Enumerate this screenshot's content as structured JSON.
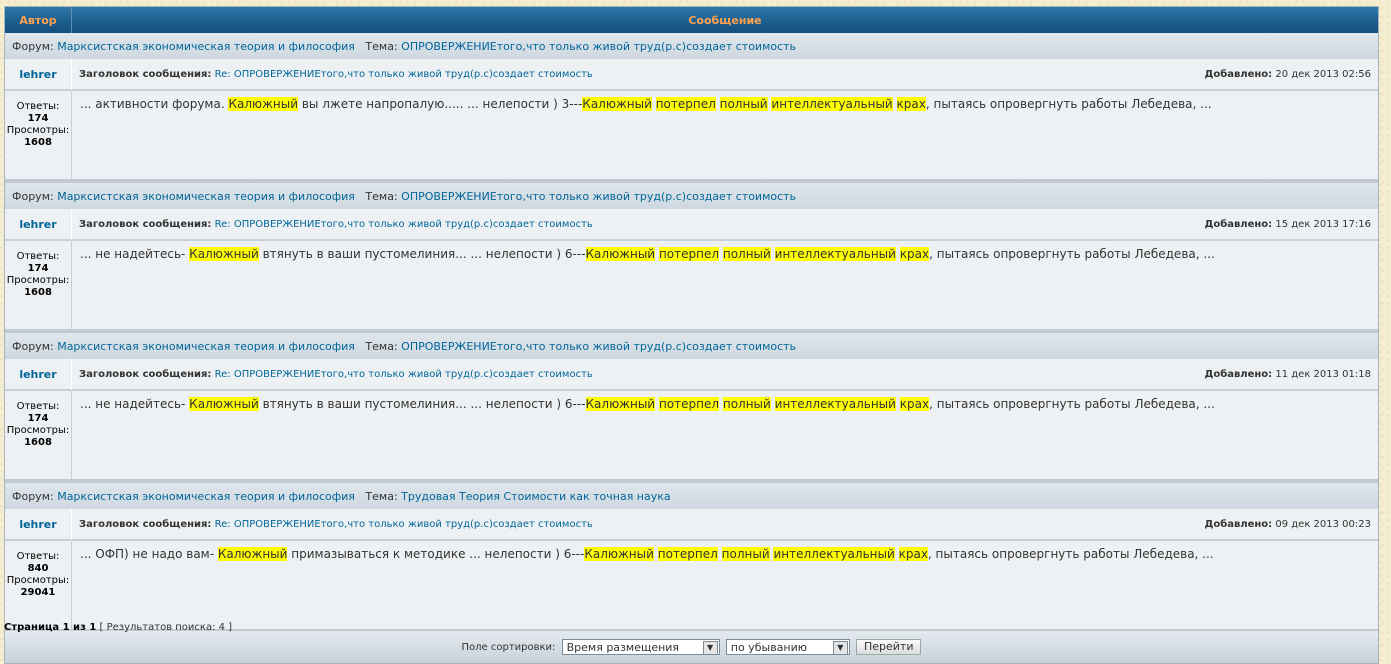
{
  "header": {
    "author": "Автор",
    "message": "Сообщение"
  },
  "labels": {
    "forum": "Форум:",
    "topic": "Тема:",
    "subject": "Заголовок сообщения:",
    "added": "Добавлено:",
    "replies": "Ответы:",
    "views": "Просмотры:"
  },
  "results": [
    {
      "forum": "Марксистская экономическая теория и философия",
      "topic": "ОПРОВЕРЖЕНИЕтого,что только живой труд(р.с)создает стоимость",
      "author": "lehrer",
      "subject": "Re: ОПРОВЕРЖЕНИЕтого,что только живой труд(р.с)создает стоимость",
      "date": "20 дек 2013 02:56",
      "replies": "174",
      "views": "1608",
      "text": [
        {
          "t": "... активности форума. ",
          "h": false
        },
        {
          "t": "Калюжный",
          "h": true
        },
        {
          "t": " вы лжете напропалую..... ... нелепости ) 3---",
          "h": false
        },
        {
          "t": "Калюжный",
          "h": true
        },
        {
          "t": " ",
          "h": false
        },
        {
          "t": "потерпел",
          "h": true
        },
        {
          "t": " ",
          "h": false
        },
        {
          "t": "полный",
          "h": true
        },
        {
          "t": " ",
          "h": false
        },
        {
          "t": "интеллектуальный",
          "h": true
        },
        {
          "t": " ",
          "h": false
        },
        {
          "t": "крах",
          "h": true
        },
        {
          "t": ", пытаясь опровергнуть работы Лебедева, ...",
          "h": false
        }
      ]
    },
    {
      "forum": "Марксистская экономическая теория и философия",
      "topic": "ОПРОВЕРЖЕНИЕтого,что только живой труд(р.с)создает стоимость",
      "author": "lehrer",
      "subject": "Re: ОПРОВЕРЖЕНИЕтого,что только живой труд(р.с)создает стоимость",
      "date": "15 дек 2013 17:16",
      "replies": "174",
      "views": "1608",
      "text": [
        {
          "t": "... не надейтесь- ",
          "h": false
        },
        {
          "t": "Калюжный",
          "h": true
        },
        {
          "t": " втянуть в ваши пустомелиния... ... нелепости ) 6---",
          "h": false
        },
        {
          "t": "Калюжный",
          "h": true
        },
        {
          "t": " ",
          "h": false
        },
        {
          "t": "потерпел",
          "h": true
        },
        {
          "t": " ",
          "h": false
        },
        {
          "t": "полный",
          "h": true
        },
        {
          "t": " ",
          "h": false
        },
        {
          "t": "интеллектуальный",
          "h": true
        },
        {
          "t": " ",
          "h": false
        },
        {
          "t": "крах",
          "h": true
        },
        {
          "t": ", пытаясь опровергнуть работы Лебедева, ...",
          "h": false
        }
      ]
    },
    {
      "forum": "Марксистская экономическая теория и философия",
      "topic": "ОПРОВЕРЖЕНИЕтого,что только живой труд(р.с)создает стоимость",
      "author": "lehrer",
      "subject": "Re: ОПРОВЕРЖЕНИЕтого,что только живой труд(р.с)создает стоимость",
      "date": "11 дек 2013 01:18",
      "replies": "174",
      "views": "1608",
      "text": [
        {
          "t": "... не надейтесь- ",
          "h": false
        },
        {
          "t": "Калюжный",
          "h": true
        },
        {
          "t": " втянуть в ваши пустомелиния... ... нелепости ) 6---",
          "h": false
        },
        {
          "t": "Калюжный",
          "h": true
        },
        {
          "t": " ",
          "h": false
        },
        {
          "t": "потерпел",
          "h": true
        },
        {
          "t": " ",
          "h": false
        },
        {
          "t": "полный",
          "h": true
        },
        {
          "t": " ",
          "h": false
        },
        {
          "t": "интеллектуальный",
          "h": true
        },
        {
          "t": " ",
          "h": false
        },
        {
          "t": "крах",
          "h": true
        },
        {
          "t": ", пытаясь опровергнуть работы Лебедева, ...",
          "h": false
        }
      ]
    },
    {
      "forum": "Марксистская экономическая теория и философия",
      "topic": "Трудовая Теория Стоимости как точная наука",
      "author": "lehrer",
      "subject": "Re: ОПРОВЕРЖЕНИЕтого,что только живой труд(р.с)создает стоимость",
      "date": "09 дек 2013 00:23",
      "replies": "840",
      "views": "29041",
      "text": [
        {
          "t": "... ОФП) не надо вам- ",
          "h": false
        },
        {
          "t": "Калюжный",
          "h": true
        },
        {
          "t": " примазываться к методике ... нелепости ) 6---",
          "h": false
        },
        {
          "t": "Калюжный",
          "h": true
        },
        {
          "t": " ",
          "h": false
        },
        {
          "t": "потерпел",
          "h": true
        },
        {
          "t": " ",
          "h": false
        },
        {
          "t": "полный",
          "h": true
        },
        {
          "t": " ",
          "h": false
        },
        {
          "t": "интеллектуальный",
          "h": true
        },
        {
          "t": " ",
          "h": false
        },
        {
          "t": "крах",
          "h": true
        },
        {
          "t": ", пытаясь опровергнуть работы Лебедева, ...",
          "h": false
        }
      ]
    }
  ],
  "sort": {
    "label": "Поле сортировки:",
    "field": "Время размещения",
    "order": "по убыванию",
    "go_button": "Перейти"
  },
  "footer": {
    "page_prefix": "Страница ",
    "page_current": "1",
    "page_of": " из ",
    "page_total": "1",
    "results_text": "[ Результатов поиска: 4 ]"
  },
  "icons": {
    "dropdown": "chevron-down-icon"
  },
  "colors": {
    "header_text": "#ffa34f",
    "link": "#006699",
    "highlight": "#ffff00"
  }
}
